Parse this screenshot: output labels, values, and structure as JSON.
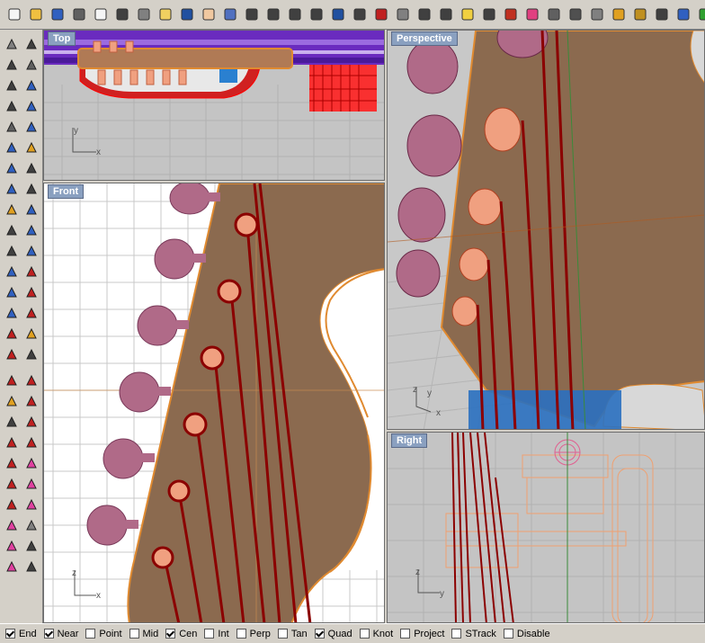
{
  "viewports": {
    "top": {
      "title": "Top",
      "axis_a": "y",
      "axis_b": "x"
    },
    "perspective": {
      "title": "Perspective",
      "axis_a": "z",
      "axis_b": "y",
      "axis_c": "x"
    },
    "front": {
      "title": "Front",
      "axis_a": "z",
      "axis_b": "x"
    },
    "right": {
      "title": "Right",
      "axis_a": "z",
      "axis_b": "y"
    }
  },
  "osnaps": [
    {
      "label": "End",
      "checked": true
    },
    {
      "label": "Near",
      "checked": true
    },
    {
      "label": "Point",
      "checked": false
    },
    {
      "label": "Mid",
      "checked": false
    },
    {
      "label": "Cen",
      "checked": true
    },
    {
      "label": "Int",
      "checked": false
    },
    {
      "label": "Perp",
      "checked": false
    },
    {
      "label": "Tan",
      "checked": false
    },
    {
      "label": "Quad",
      "checked": true
    },
    {
      "label": "Knot",
      "checked": false
    },
    {
      "label": "Project",
      "checked": false
    },
    {
      "label": "STrack",
      "checked": false
    },
    {
      "label": "Disable",
      "checked": false
    }
  ],
  "toolbar_icons": [
    "new-file-icon",
    "open-folder-icon",
    "save-icon",
    "print-icon",
    "import-icon",
    "cut-icon",
    "copy-icon",
    "paste-icon",
    "undo-icon",
    "pan-hand-icon",
    "rotate-view-icon",
    "zoom-icon",
    "zoom-window-icon",
    "zoom-extents-icon",
    "zoom-selected-icon",
    "undo-view-icon",
    "four-viewports-icon",
    "car-render-icon",
    "grid-icon",
    "target-icon",
    "point-icon",
    "lightbulb-icon",
    "lock-icon",
    "shield-icon",
    "color-wheel-icon",
    "sphere-wireframe-icon",
    "sphere-shaded-icon",
    "sphere-rendered-icon",
    "flag-icon",
    "gear-icon",
    "options-icon",
    "help-icon",
    "edit-icon",
    "globe-icon"
  ],
  "colors": {
    "grid_bg": "#c8c8c8",
    "grid_line": "#b0b0b0",
    "headstock": "#8b6a4f",
    "outline": "#e08a30",
    "string": "#8b0000",
    "tuner": "#b06a88",
    "purple": "#6a2bbf"
  }
}
